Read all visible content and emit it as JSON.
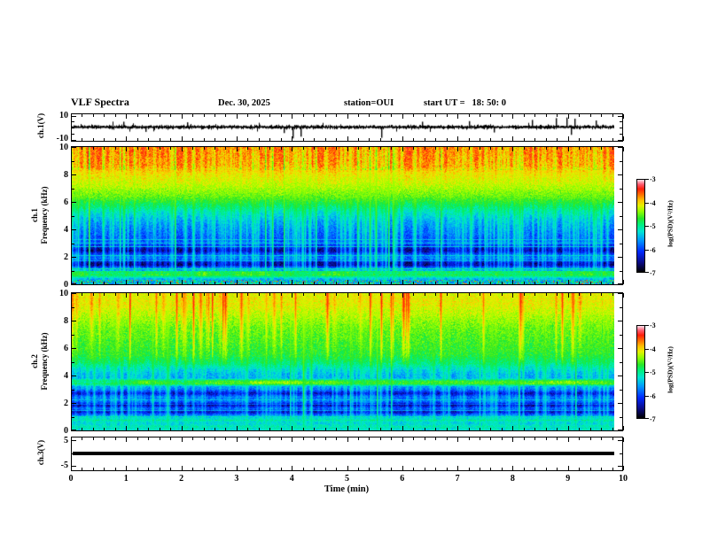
{
  "header": {
    "title": "VLF Spectra",
    "date": "Dec. 30, 2025",
    "station": "station=OUI",
    "start_ut": "start UT =   18: 50: 0"
  },
  "time_axis": {
    "label": "Time (min)",
    "tick_labels": [
      "0",
      "1",
      "2",
      "3",
      "4",
      "5",
      "6",
      "7",
      "8",
      "9",
      "10"
    ],
    "minor_tick_step_min": 0.2
  },
  "panels": {
    "ch1_wave": {
      "ylabel": "ch.1(V)",
      "ytop_label": "10",
      "ybottom_label": "-10"
    },
    "ch1_spec": {
      "name_label": "ch.1",
      "ylabel": "Frequency (kHz)",
      "ytick_labels": [
        "10",
        "8",
        "6",
        "4",
        "2",
        "0"
      ]
    },
    "ch2_spec": {
      "name_label": "ch.2",
      "ylabel": "Frequency (kHz)",
      "ytick_labels": [
        "10",
        "8",
        "6",
        "4",
        "2",
        "0"
      ]
    },
    "ch3_wave": {
      "ylabel": "ch.3(V)",
      "ytop_label": "5",
      "ybottom_label": "-5"
    }
  },
  "colorbars": [
    {
      "label": "log(PSD)(V²/Hz)",
      "tick_labels": [
        "-3",
        "-4",
        "-5",
        "-6",
        "-7"
      ]
    },
    {
      "label": "log(PSD)(V²/Hz)",
      "tick_labels": [
        "-3",
        "-4",
        "-5",
        "-6",
        "-7"
      ]
    }
  ],
  "colormap": {
    "stops": [
      [
        0,
        "#000000"
      ],
      [
        0.1,
        "#0a0a82"
      ],
      [
        0.22,
        "#0028ff"
      ],
      [
        0.34,
        "#0096ff"
      ],
      [
        0.44,
        "#00e6d2"
      ],
      [
        0.52,
        "#00f078"
      ],
      [
        0.58,
        "#28e628"
      ],
      [
        0.66,
        "#96ff00"
      ],
      [
        0.72,
        "#e6f000"
      ],
      [
        0.78,
        "#ffbe00"
      ],
      [
        0.84,
        "#ff6e00"
      ],
      [
        0.9,
        "#ff1e0a"
      ],
      [
        0.95,
        "#ff5a6e"
      ],
      [
        1,
        "#ffe1eb"
      ]
    ]
  },
  "chart_data": [
    {
      "type": "line",
      "panel": "ch.1 time series",
      "ylabel": "ch.1(V)",
      "ylim": [
        -10,
        10
      ],
      "xlim_min": [
        0,
        10
      ],
      "description": "broadband noise of roughly ±2 V about 0 V for the full 10 min, with impulsive spikes reaching toward ±10 V",
      "noise_sigma_v": 1.5,
      "seed": 11,
      "spikes": [
        {
          "t_min": 0.95,
          "v": 4.5
        },
        {
          "t_min": 1.35,
          "v": -4
        },
        {
          "t_min": 2.1,
          "v": 4
        },
        {
          "t_min": 3.85,
          "v": -5
        },
        {
          "t_min": 4.02,
          "v": -9.5
        },
        {
          "t_min": 4.15,
          "v": -8
        },
        {
          "t_min": 5.62,
          "v": -9
        },
        {
          "t_min": 6.35,
          "v": 4.5
        },
        {
          "t_min": 7.2,
          "v": 5
        },
        {
          "t_min": 7.65,
          "v": -4.5
        },
        {
          "t_min": 8.35,
          "v": 6
        },
        {
          "t_min": 8.78,
          "v": 7.5
        },
        {
          "t_min": 8.98,
          "v": 8
        },
        {
          "t_min": 9.05,
          "v": -6.5
        },
        {
          "t_min": 9.12,
          "v": 7
        },
        {
          "t_min": 9.5,
          "v": 5.5
        },
        {
          "t_min": 9.88,
          "v": -7
        }
      ]
    },
    {
      "type": "heatmap",
      "panel": "ch.1 spectrogram",
      "ylabel": "Frequency (kHz)",
      "ylim_khz": [
        0,
        10
      ],
      "xlim_min": [
        0,
        10
      ],
      "value_label": "log(PSD)(V²/Hz)",
      "value_range": [
        -7,
        -3
      ],
      "value_note": "color t=0 maps to -7 (black), t=1 maps to -3 (white-pink)",
      "seed": 101,
      "noise": 0.13,
      "freq_profile": [
        [
          10,
          0.87
        ],
        [
          8.6,
          0.84
        ],
        [
          8.1,
          0.76
        ],
        [
          7.2,
          0.7
        ],
        [
          6.4,
          0.62
        ],
        [
          5.8,
          0.52
        ],
        [
          5.2,
          0.42
        ],
        [
          4.6,
          0.34
        ],
        [
          4.0,
          0.29
        ],
        [
          3.3,
          0.24
        ],
        [
          3.0,
          0.26
        ],
        [
          2.7,
          0.14
        ],
        [
          2.45,
          0.07
        ],
        [
          2.15,
          0.25
        ],
        [
          1.85,
          0.28
        ],
        [
          1.6,
          0.1
        ],
        [
          1.4,
          0.07
        ],
        [
          1.2,
          0.27
        ],
        [
          1.0,
          0.45
        ],
        [
          0.88,
          0.72
        ],
        [
          0.7,
          0.76
        ],
        [
          0.55,
          0.58
        ],
        [
          0.42,
          0.38
        ],
        [
          0.3,
          0.32
        ],
        [
          0,
          0.3
        ]
      ],
      "horizontal_lines_khz": [
        [
          3.3,
          0.5,
          0.5
        ],
        [
          3.05,
          0.48,
          0.5
        ],
        [
          2.8,
          0.52,
          0.6
        ],
        [
          2.1,
          0.5,
          0.5
        ],
        [
          1.75,
          0.48,
          0.5
        ],
        [
          1.15,
          0.55,
          0.6
        ],
        [
          0.95,
          0.6,
          0.5
        ]
      ],
      "streaks": {
        "count": 260,
        "strength": [
          0.08,
          0.55
        ],
        "strong": 14,
        "seed": 7
      },
      "streak_darken_above_khz": 8.3,
      "band_mod": {
        "center_khz": 0.78,
        "width_khz": 0.4,
        "amount": 0.5
      },
      "bottom_speckle_below_khz": 0.3
    },
    {
      "type": "heatmap",
      "panel": "ch.2 spectrogram",
      "ylabel": "Frequency (kHz)",
      "ylim_khz": [
        0,
        10
      ],
      "xlim_min": [
        0,
        10
      ],
      "value_label": "log(PSD)(V²/Hz)",
      "value_range": [
        -7,
        -3
      ],
      "value_note": "green-dominated field above 4 kHz with red sferic streaks; bright green band near 3.5 kHz; banded blue/black below 3 kHz",
      "seed": 202,
      "noise": 0.13,
      "freq_profile": [
        [
          10,
          0.72
        ],
        [
          9.2,
          0.73
        ],
        [
          8.4,
          0.68
        ],
        [
          7.5,
          0.62
        ],
        [
          6.5,
          0.59
        ],
        [
          5.5,
          0.56
        ],
        [
          4.9,
          0.5
        ],
        [
          4.5,
          0.42
        ],
        [
          4.1,
          0.36
        ],
        [
          3.8,
          0.35
        ],
        [
          3.6,
          0.6
        ],
        [
          3.4,
          0.62
        ],
        [
          3.2,
          0.34
        ],
        [
          2.95,
          0.28
        ],
        [
          2.7,
          0.12
        ],
        [
          2.45,
          0.28
        ],
        [
          2.1,
          0.27
        ],
        [
          1.85,
          0.09
        ],
        [
          1.6,
          0.27
        ],
        [
          1.35,
          0.12
        ],
        [
          1.1,
          0.3
        ],
        [
          0.9,
          0.42
        ],
        [
          0.7,
          0.44
        ],
        [
          0.5,
          0.4
        ],
        [
          0.3,
          0.46
        ],
        [
          0,
          0.42
        ]
      ],
      "horizontal_lines_khz": [
        [
          2.25,
          0.48,
          0.5
        ],
        [
          1.95,
          0.45,
          0.4
        ],
        [
          1.5,
          0.5,
          0.5
        ],
        [
          1.05,
          0.52,
          0.5
        ],
        [
          0.8,
          0.55,
          0.45
        ]
      ],
      "streaks": {
        "count": 230,
        "strength": [
          0.08,
          0.5
        ],
        "strong": 10,
        "seed": 13
      },
      "hot_streaks": {
        "count": 45,
        "above_khz": 4.5,
        "strength": [
          0.25,
          0.85
        ],
        "seed": 29
      },
      "band_mod": {
        "center_khz": 3.5,
        "width_khz": 0.25,
        "amount": 0.35
      }
    },
    {
      "type": "line",
      "panel": "ch.3 time series",
      "ylabel": "ch.3(V)",
      "ylim": [
        -5,
        5
      ],
      "xlim_min": [
        0,
        10
      ],
      "description": "constant 0 V — flat thick black line for the full record",
      "value_v": 0
    }
  ]
}
